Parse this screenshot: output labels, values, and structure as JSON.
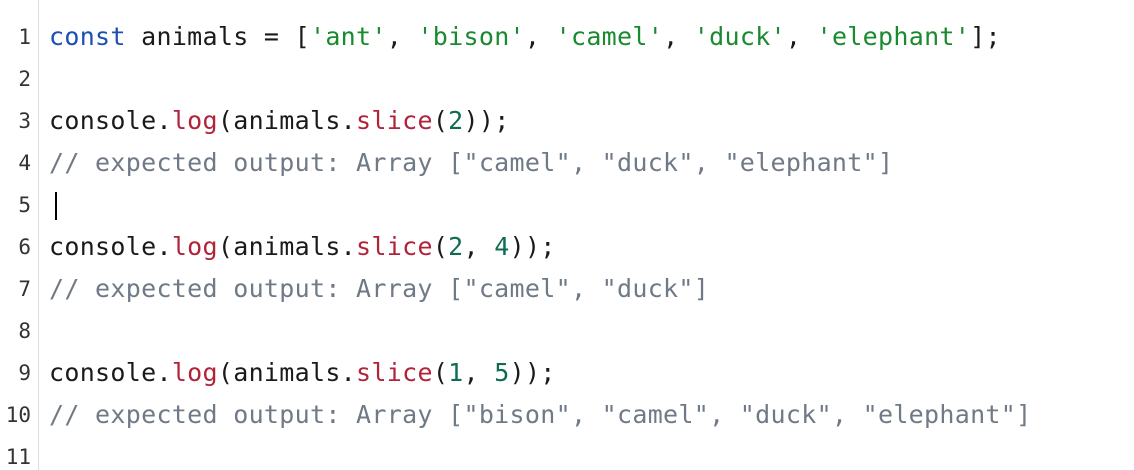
{
  "colors": {
    "keyword": "#1a4fb3",
    "string": "#1a8a2e",
    "method": "#b0243b",
    "number": "#0f6b55",
    "comment": "#707a86",
    "plain": "#1a1a1a"
  },
  "editor": {
    "cursor_line": 5,
    "lines": [
      {
        "number": "1",
        "tokens": [
          {
            "type": "keyword",
            "text": "const"
          },
          {
            "type": "plain",
            "text": " animals = ["
          },
          {
            "type": "string",
            "text": "'ant'"
          },
          {
            "type": "plain",
            "text": ", "
          },
          {
            "type": "string",
            "text": "'bison'"
          },
          {
            "type": "plain",
            "text": ", "
          },
          {
            "type": "string",
            "text": "'camel'"
          },
          {
            "type": "plain",
            "text": ", "
          },
          {
            "type": "string",
            "text": "'duck'"
          },
          {
            "type": "plain",
            "text": ", "
          },
          {
            "type": "string",
            "text": "'elephant'"
          },
          {
            "type": "plain",
            "text": "];"
          }
        ]
      },
      {
        "number": "2",
        "tokens": []
      },
      {
        "number": "3",
        "tokens": [
          {
            "type": "plain",
            "text": "console."
          },
          {
            "type": "method",
            "text": "log"
          },
          {
            "type": "plain",
            "text": "(animals."
          },
          {
            "type": "method",
            "text": "slice"
          },
          {
            "type": "plain",
            "text": "("
          },
          {
            "type": "number",
            "text": "2"
          },
          {
            "type": "plain",
            "text": "));"
          }
        ]
      },
      {
        "number": "4",
        "tokens": [
          {
            "type": "comment",
            "text": "// expected output: Array [\"camel\", \"duck\", \"elephant\"]"
          }
        ]
      },
      {
        "number": "5",
        "tokens": []
      },
      {
        "number": "6",
        "tokens": [
          {
            "type": "plain",
            "text": "console."
          },
          {
            "type": "method",
            "text": "log"
          },
          {
            "type": "plain",
            "text": "(animals."
          },
          {
            "type": "method",
            "text": "slice"
          },
          {
            "type": "plain",
            "text": "("
          },
          {
            "type": "number",
            "text": "2"
          },
          {
            "type": "plain",
            "text": ", "
          },
          {
            "type": "number",
            "text": "4"
          },
          {
            "type": "plain",
            "text": "));"
          }
        ]
      },
      {
        "number": "7",
        "tokens": [
          {
            "type": "comment",
            "text": "// expected output: Array [\"camel\", \"duck\"]"
          }
        ]
      },
      {
        "number": "8",
        "tokens": []
      },
      {
        "number": "9",
        "tokens": [
          {
            "type": "plain",
            "text": "console."
          },
          {
            "type": "method",
            "text": "log"
          },
          {
            "type": "plain",
            "text": "(animals."
          },
          {
            "type": "method",
            "text": "slice"
          },
          {
            "type": "plain",
            "text": "("
          },
          {
            "type": "number",
            "text": "1"
          },
          {
            "type": "plain",
            "text": ", "
          },
          {
            "type": "number",
            "text": "5"
          },
          {
            "type": "plain",
            "text": "));"
          }
        ]
      },
      {
        "number": "10",
        "tokens": [
          {
            "type": "comment",
            "text": "// expected output: Array [\"bison\", \"camel\", \"duck\", \"elephant\"]"
          }
        ]
      },
      {
        "number": "11",
        "tokens": []
      }
    ]
  }
}
